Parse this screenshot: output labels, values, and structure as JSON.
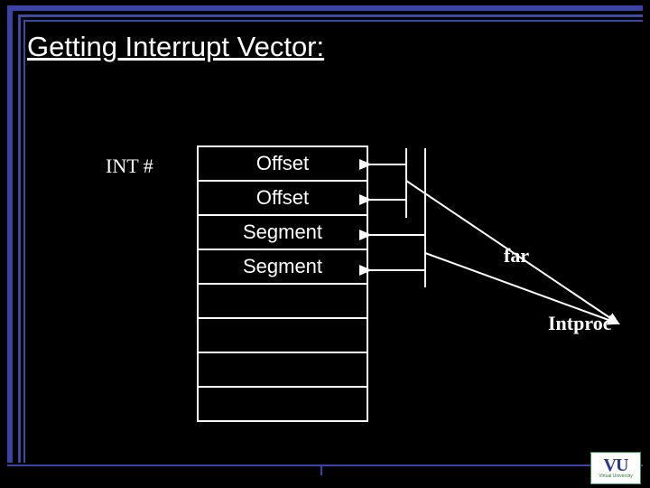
{
  "title": "Getting Interrupt Vector:",
  "int_label": "INT #",
  "table_rows": [
    "Offset",
    "Offset",
    "Segment",
    "Segment",
    "",
    "",
    "",
    ""
  ],
  "far_label": "far",
  "intproc_label": "Intproc",
  "logo": {
    "big": "VU",
    "small": "Virtual University"
  },
  "colors": {
    "frame": "#3844a8",
    "text": "#ffffff",
    "bg": "#000000"
  }
}
